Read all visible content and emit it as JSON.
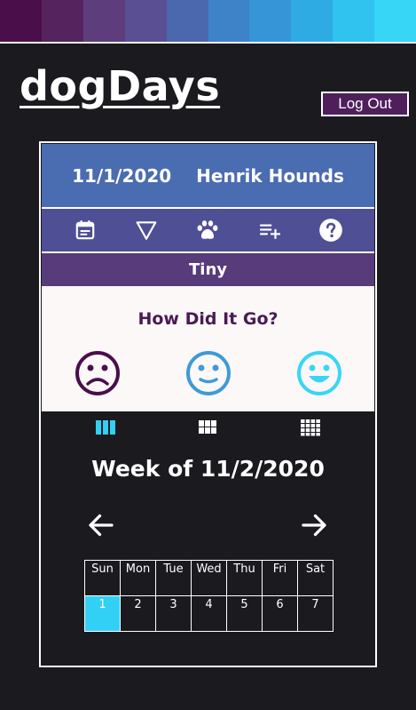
{
  "palette": [
    "#4a0e4a",
    "#55235e",
    "#5e3d7c",
    "#5a4f92",
    "#4b68ae",
    "#3e82c7",
    "#3595d6",
    "#2eabe3",
    "#30c3ef",
    "#37d6f7"
  ],
  "app": {
    "title": "dogDays",
    "logout_label": "Log Out"
  },
  "header": {
    "date": "11/1/2020",
    "user": "Henrik Hounds"
  },
  "icons": [
    "calendar-icon",
    "filter-icon",
    "paw-icon",
    "playlist-add-icon",
    "help-icon"
  ],
  "dog_name": "Tiny",
  "mood": {
    "title": "How Did It Go?",
    "faces": [
      {
        "name": "sad-face-icon",
        "color": "#4a0e4a"
      },
      {
        "name": "neutral-face-icon",
        "color": "#3e9ad8"
      },
      {
        "name": "happy-face-icon",
        "color": "#37d6f7"
      }
    ]
  },
  "views": [
    "week-view-icon",
    "month-view-icon",
    "year-view-icon"
  ],
  "week": {
    "title": "Week of 11/2/2020",
    "days": [
      "Sun",
      "Mon",
      "Tue",
      "Wed",
      "Thu",
      "Fri",
      "Sat"
    ],
    "dates": [
      "1",
      "2",
      "3",
      "4",
      "5",
      "6",
      "7"
    ],
    "selected_date": "1"
  }
}
